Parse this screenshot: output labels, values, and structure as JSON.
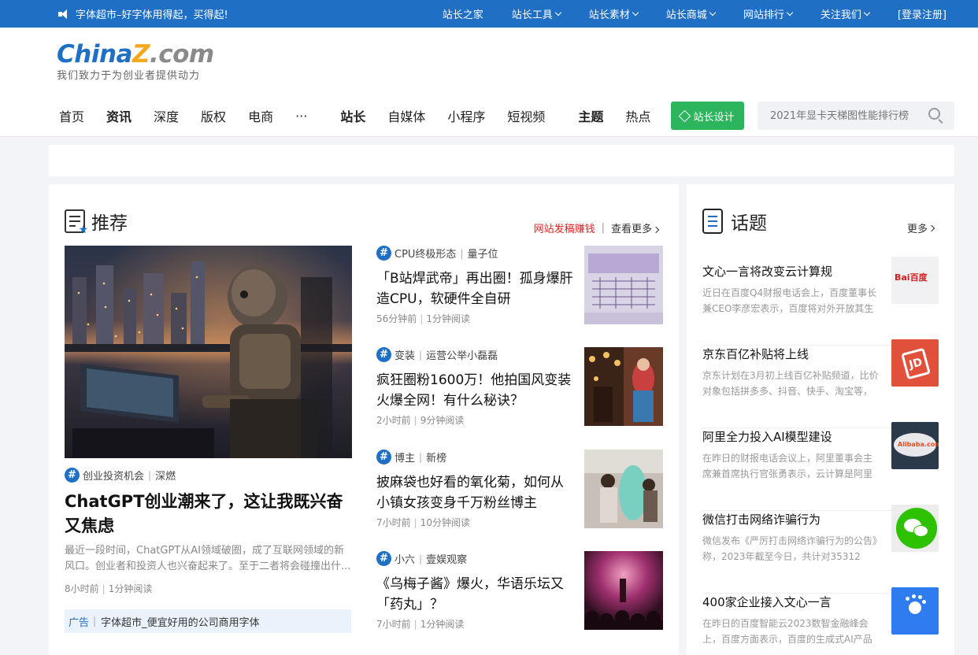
{
  "topbar": {
    "notice": "字体超市–好字体用得起，买得起!",
    "nav": [
      {
        "label": "站长之家",
        "dropdown": false
      },
      {
        "label": "站长工具",
        "dropdown": true
      },
      {
        "label": "站长素材",
        "dropdown": true
      },
      {
        "label": "站长商城",
        "dropdown": true
      },
      {
        "label": "网站排行",
        "dropdown": true
      },
      {
        "label": "关注我们",
        "dropdown": true
      },
      {
        "label": "[登录注册]",
        "dropdown": false
      }
    ]
  },
  "logo": {
    "part1": "China",
    "part2": "Z",
    "part3": ".com",
    "slogan": "我们致力于为创业者提供动力"
  },
  "mainnav": [
    "首页",
    "资讯",
    "深度",
    "版权",
    "电商",
    "···",
    "站长",
    "自媒体",
    "小程序",
    "短视频",
    "主题",
    "热点"
  ],
  "design_button": "站长设计",
  "search": {
    "placeholder": "2021年显卡天梯图性能排行榜"
  },
  "recommend": {
    "title": "推荐",
    "link_red": "网站发稿赚钱",
    "link_more": "查看更多",
    "feature": {
      "tag1": "创业投资机会",
      "tag2": "深燃",
      "title": "ChatGPT创业潮来了，这让我既兴奋又焦虑",
      "summary": "最近一段时间，ChatGPT从AI领域破圈，成了互联网领域的新风口。创业者和投资人也兴奋起来了。至于二者将会碰撞出什...",
      "time": "8小时前",
      "read": "1分钟阅读"
    },
    "ad": {
      "tag": "广告",
      "text": "字体超市_便宜好用的公司商用字体"
    },
    "articles": [
      {
        "tag1": "CPU终极形态",
        "tag2": "量子位",
        "title": "「B站焊武帝」再出圈！孤身爆肝造CPU，软硬件全自研",
        "time": "56分钟前",
        "read": "1分钟阅读"
      },
      {
        "tag1": "变装",
        "tag2": "运营公举小磊磊",
        "title": "疯狂圈粉1600万！他拍国风变装火爆全网！有什么秘诀？",
        "time": "2小时前",
        "read": "9分钟阅读"
      },
      {
        "tag1": "博主",
        "tag2": "新榜",
        "title": "披麻袋也好看的氧化菊，如何从小镇女孩变身千万粉丝博主",
        "time": "7小时前",
        "read": "10分钟阅读"
      },
      {
        "tag1": "小六",
        "tag2": "壹娱观察",
        "title": "《乌梅子酱》爆火，华语乐坛又「药丸」？",
        "time": "7小时前",
        "read": "1分钟阅读"
      }
    ]
  },
  "topics": {
    "title": "话题",
    "more": "更多",
    "items": [
      {
        "title": "文心一言将改变云计算规",
        "desc": "近日在百度Q4财报电话会上，百度董事长兼CEO李彦宏表示，百度将对外开放其生",
        "thumb_text": "Bai百度"
      },
      {
        "title": "京东百亿补贴将上线",
        "desc": "京东计划在3月初上线百亿补贴频道，比价对象包括拼多多、抖音、快手、淘宝等，",
        "thumb_text": "JD"
      },
      {
        "title": "阿里全力投入AI模型建设",
        "desc": "在昨日的财报电话会议上，阿里董事会主席兼首席执行官张勇表示，云计算是阿里",
        "thumb_text": "Alibaba.com"
      },
      {
        "title": "微信打击网络诈骗行为",
        "desc": "微信发布《严厉打击网络诈骗行为的公告》称，2023年截至今日，共计对35312",
        "thumb_text": ""
      },
      {
        "title": "400家企业接入文心一言",
        "desc": "在昨日的百度智能云2023数智金融峰会上，百度方面表示，百度的生成式AI产品",
        "thumb_text": ""
      }
    ]
  }
}
